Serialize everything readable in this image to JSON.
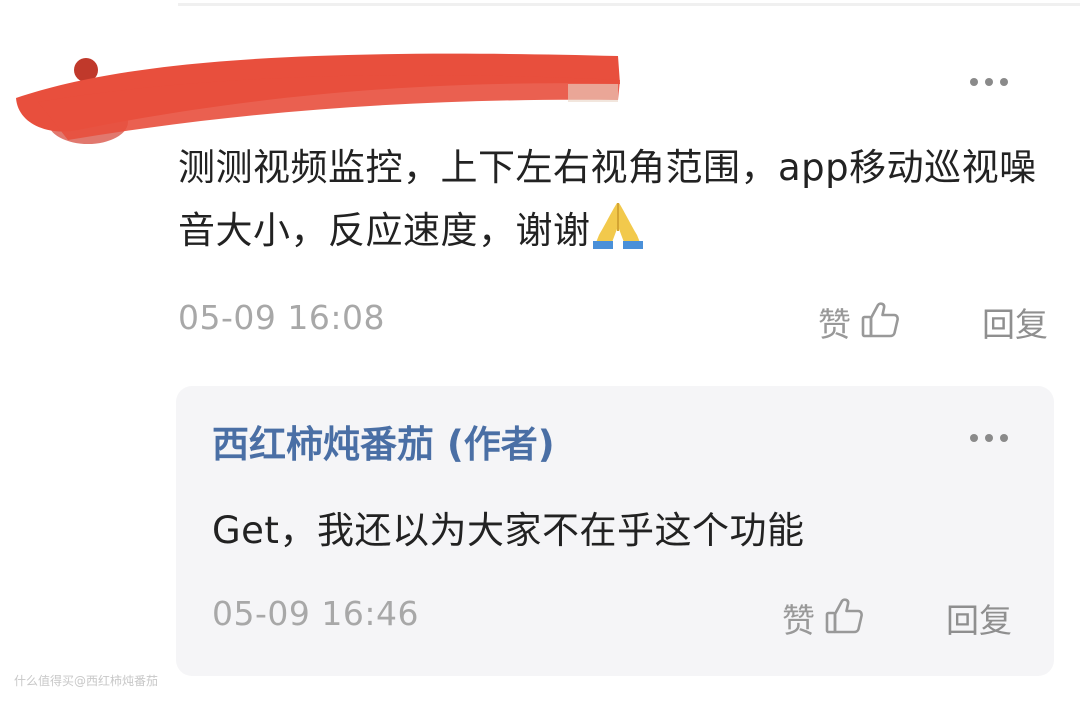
{
  "comment": {
    "text": "测测视频监控，上下左右视角范围，app移动巡视噪音大小，反应速度，谢谢",
    "emoji": "🙏",
    "timestamp": "05-09 16:08",
    "like_label": "赞",
    "reply_label": "回复"
  },
  "reply": {
    "author": "西红柿炖番茄 (作者)",
    "text": "Get，我还以为大家不在乎这个功能",
    "timestamp": "05-09 16:46",
    "like_label": "赞",
    "reply_label": "回复"
  },
  "watermark": "什么值得买@西红柿炖番茄",
  "icons": {
    "more": "more-dots-icon",
    "like": "thumbs-up-icon",
    "emoji": "folded-hands-emoji"
  },
  "colors": {
    "author_link": "#4a6fa5",
    "redaction": "#e84f3d",
    "muted_text": "#a8a8a8",
    "reply_bg": "#f5f5f7"
  }
}
